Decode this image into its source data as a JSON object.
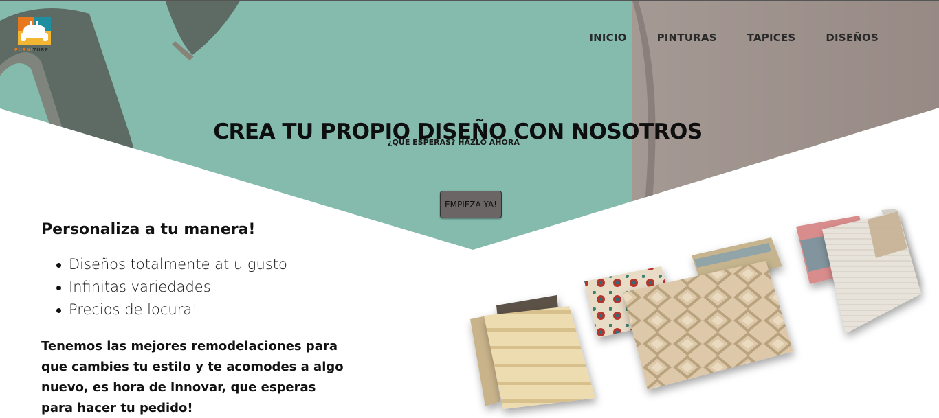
{
  "brand": {
    "name_prefix": "FURNI",
    "name_suffix": "TURE",
    "colors": {
      "orange": "#e8771d",
      "teal": "#1f8ea0",
      "yellow": "#f2b632"
    }
  },
  "nav": {
    "items": [
      {
        "label": "INICIO"
      },
      {
        "label": "PINTURAS"
      },
      {
        "label": "TAPICES"
      },
      {
        "label": "DISEÑOS"
      }
    ]
  },
  "hero": {
    "title": "CREA TU PROPIO DISEÑO CON NOSOTROS",
    "subtitle": "¿QUE ESPERAS? HAZLO AHORA",
    "cta_label": "EMPIEZA YA!",
    "colors": {
      "mint": "#84bbad",
      "taupe": "#9b8e89",
      "shape": "#5e6b64"
    }
  },
  "features": {
    "heading": "Personaliza a tu manera!",
    "items": [
      "Diseños totalmente at u gusto",
      "Infinitas variedades",
      "Precios de locura!"
    ],
    "paragraph": "Tenemos las mejores remodelaciones para que cambies tu estilo y te acomodes a algo nuevo, es hora de innovar, que esperas para hacer tu pedido!"
  },
  "gallery": {
    "image_label": "rugs-collage"
  }
}
